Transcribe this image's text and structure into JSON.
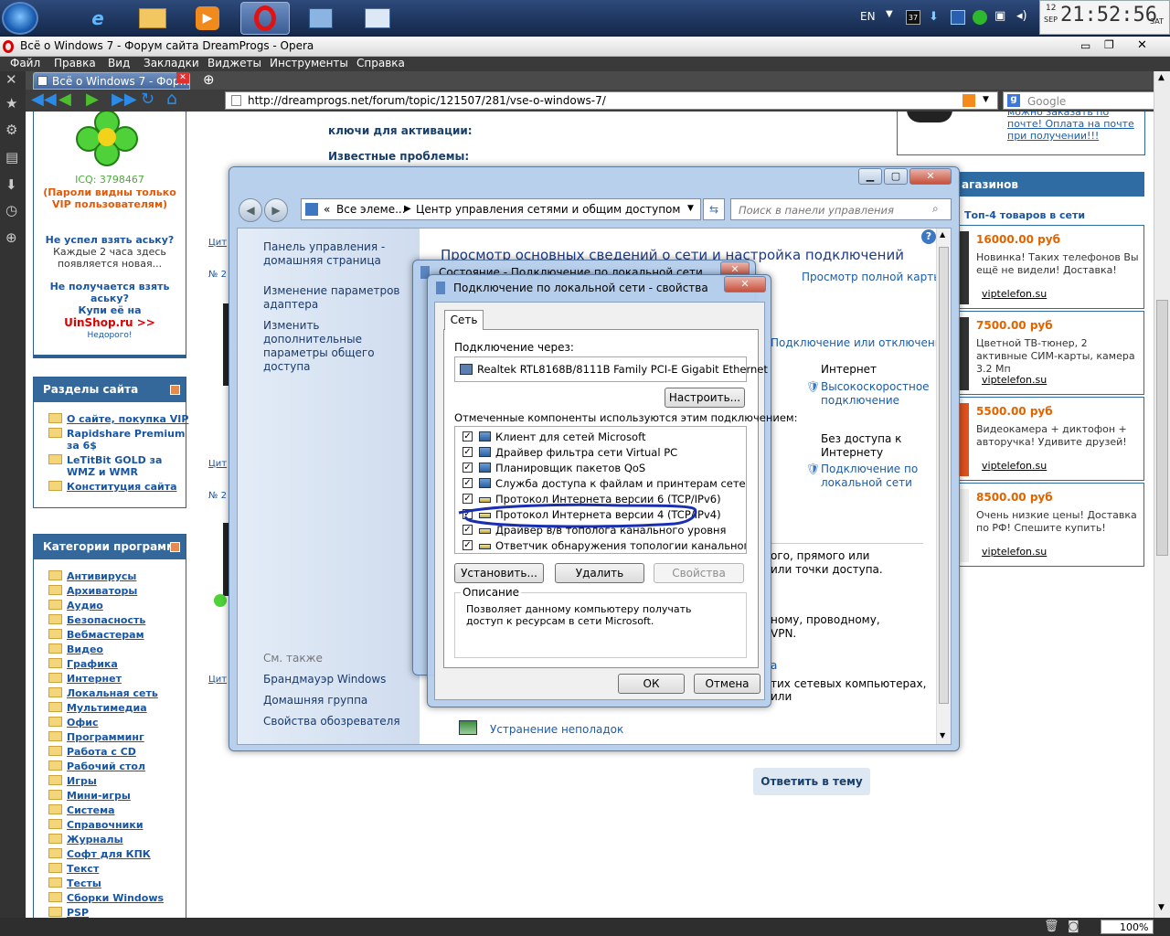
{
  "taskbar": {
    "lang": "EN",
    "tray_badge": "37",
    "clock_day": "12",
    "clock_month": "SEP",
    "clock_time": "21:52:56",
    "clock_weekday": "SAT",
    "apps": [
      "ie-icon",
      "explorer-icon",
      "media-player-icon",
      "opera-icon",
      "network-icon",
      "control-panel-icon"
    ]
  },
  "browser": {
    "title": "Всё о Windows 7 - Форум сайта DreamProgs - Opera",
    "menu": [
      "Файл",
      "Правка",
      "Вид",
      "Закладки",
      "Виджеты",
      "Инструменты",
      "Справка"
    ],
    "tab_label": "Всё о Windows 7 - Фор...",
    "url": "http://dreamprogs.net/forum/topic/121507/281/vse-o-windows-7/",
    "search_engine": "Google",
    "zoom": "100%"
  },
  "page": {
    "icq_label": "ICQ: 3798467",
    "vip_note": "(Пароли видны только VIP пользователям)",
    "promo1_title": "Не успел взять аську?",
    "promo1_text": "Каждые 2 часа здесь появляется новая...",
    "promo2_title": "Не получается взять аську?",
    "promo2_text": "Купи её на",
    "promo2_shop": "UinShop.ru >>",
    "promo2_cheap": "Недорого!",
    "sections_title": "Разделы сайта",
    "sections": [
      "О сайте, покупка VIP",
      "Rapidshare Premium за 6$",
      "LeTitBit GOLD за WMZ и WMR",
      "Конституция сайта"
    ],
    "categories_title": "Категории программ",
    "categories": [
      "Антивирусы",
      "Архиваторы",
      "Аудио",
      "Безопасность",
      "Вебмастерам",
      "Видео",
      "Графика",
      "Интернет",
      "Локальная сеть",
      "Мультимедиа",
      "Офис",
      "Программинг",
      "Работа с CD",
      "Рабочий стол",
      "Игры",
      "Мини-игры",
      "Система",
      "Справочники",
      "Журналы",
      "Софт для КПК",
      "Текст",
      "Тесты",
      "Сборки Windows",
      "PSP"
    ],
    "post_line1": "ключи для активации:",
    "post_line2": "Известные проблемы:",
    "reply_button": "Ответить в тему",
    "cite_label": "Цит",
    "post_num": "№ 2",
    "right_top_links": "можно заказать по почте! Оплата на почте при получении!!!",
    "shops_title": "агазинов",
    "top4_title": "Топ-4 товаров в сети",
    "ads": [
      {
        "price": "16000.00 руб",
        "text": "Новинка! Таких телефонов Вы ещё не видели! Доставка!",
        "link": "viptelefon.su"
      },
      {
        "price": "7500.00 руб",
        "text": "Цветной ТВ-тюнер, 2 активные СИМ-карты, камера 3.2 Мп",
        "link": "viptelefon.su"
      },
      {
        "price": "5500.00 руб",
        "text": "Видеокамера + диктофон + авторучка! Удивите друзей!",
        "link": "viptelefon.su"
      },
      {
        "price": "8500.00 руб",
        "text": "Очень низкие цены! Доставка по РФ! Спешите купить!",
        "link": "viptelefon.su"
      }
    ]
  },
  "control_panel": {
    "breadcrumb_root": "Все элеме...",
    "breadcrumb_current": "Центр управления сетями и общим доступом",
    "search_placeholder": "Поиск в панели управления",
    "left_links": [
      "Панель управления - домашняя страница",
      "Изменение параметров адаптера",
      "Изменить дополнительные параметры общего доступа"
    ],
    "see_also": "См. также",
    "see_also_links": [
      "Брандмауэр Windows",
      "Домашняя группа",
      "Свойства обозревателя"
    ],
    "heading": "Просмотр основных сведений о сети и настройка подключений",
    "full_map": "Просмотр полной карты",
    "connect_disconnect": "Подключение или отключение",
    "internet_label": "Интернет",
    "highspeed_link": "Высокоскоростное подключение",
    "no_access": "Без доступа к Интернету",
    "lan_link": "Подключение по локальной сети",
    "frag1": "ого, прямого или",
    "frag2": "или точки доступа.",
    "frag3": "ному, проводному,",
    "frag4": "VPN.",
    "frag5": "а",
    "frag6": "тих сетевых компьютерах, или",
    "troubleshoot": "Устранение неполадок"
  },
  "status_dialog": {
    "title": "Состояние - Подключение по локальной сети"
  },
  "properties_dialog": {
    "title": "Подключение по локальной сети - свойства",
    "tab": "Сеть",
    "connect_through_label": "Подключение через:",
    "adapter": "Realtek RTL8168B/8111B Family PCI-E Gigabit Ethernet",
    "configure_button": "Настроить...",
    "components_label": "Отмеченные компоненты используются этим подключением:",
    "components": [
      {
        "label": "Клиент для сетей Microsoft",
        "checked": true
      },
      {
        "label": "Драйвер фильтра сети Virtual PC",
        "checked": true
      },
      {
        "label": "Планировщик пакетов QoS",
        "checked": true
      },
      {
        "label": "Служба доступа к файлам и принтерам сетей Micro...",
        "checked": true
      },
      {
        "label": "Протокол Интернета версии 6 (TCP/IPv6)",
        "checked": true
      },
      {
        "label": "Протокол Интернета версии 4 (TCP/IPv4)",
        "checked": true
      },
      {
        "label": "Драйвер в/в тополога канального уровня",
        "checked": true
      },
      {
        "label": "Ответчик обнаружения топологии канального уровня",
        "checked": true
      }
    ],
    "install_button": "Установить...",
    "remove_button": "Удалить",
    "properties_button": "Свойства",
    "description_title": "Описание",
    "description_text": "Позволяет данному компьютеру получать доступ к ресурсам в сети Microsoft.",
    "ok_button": "ОК",
    "cancel_button": "Отмена",
    "annotation_color": "#1a2fb0"
  }
}
